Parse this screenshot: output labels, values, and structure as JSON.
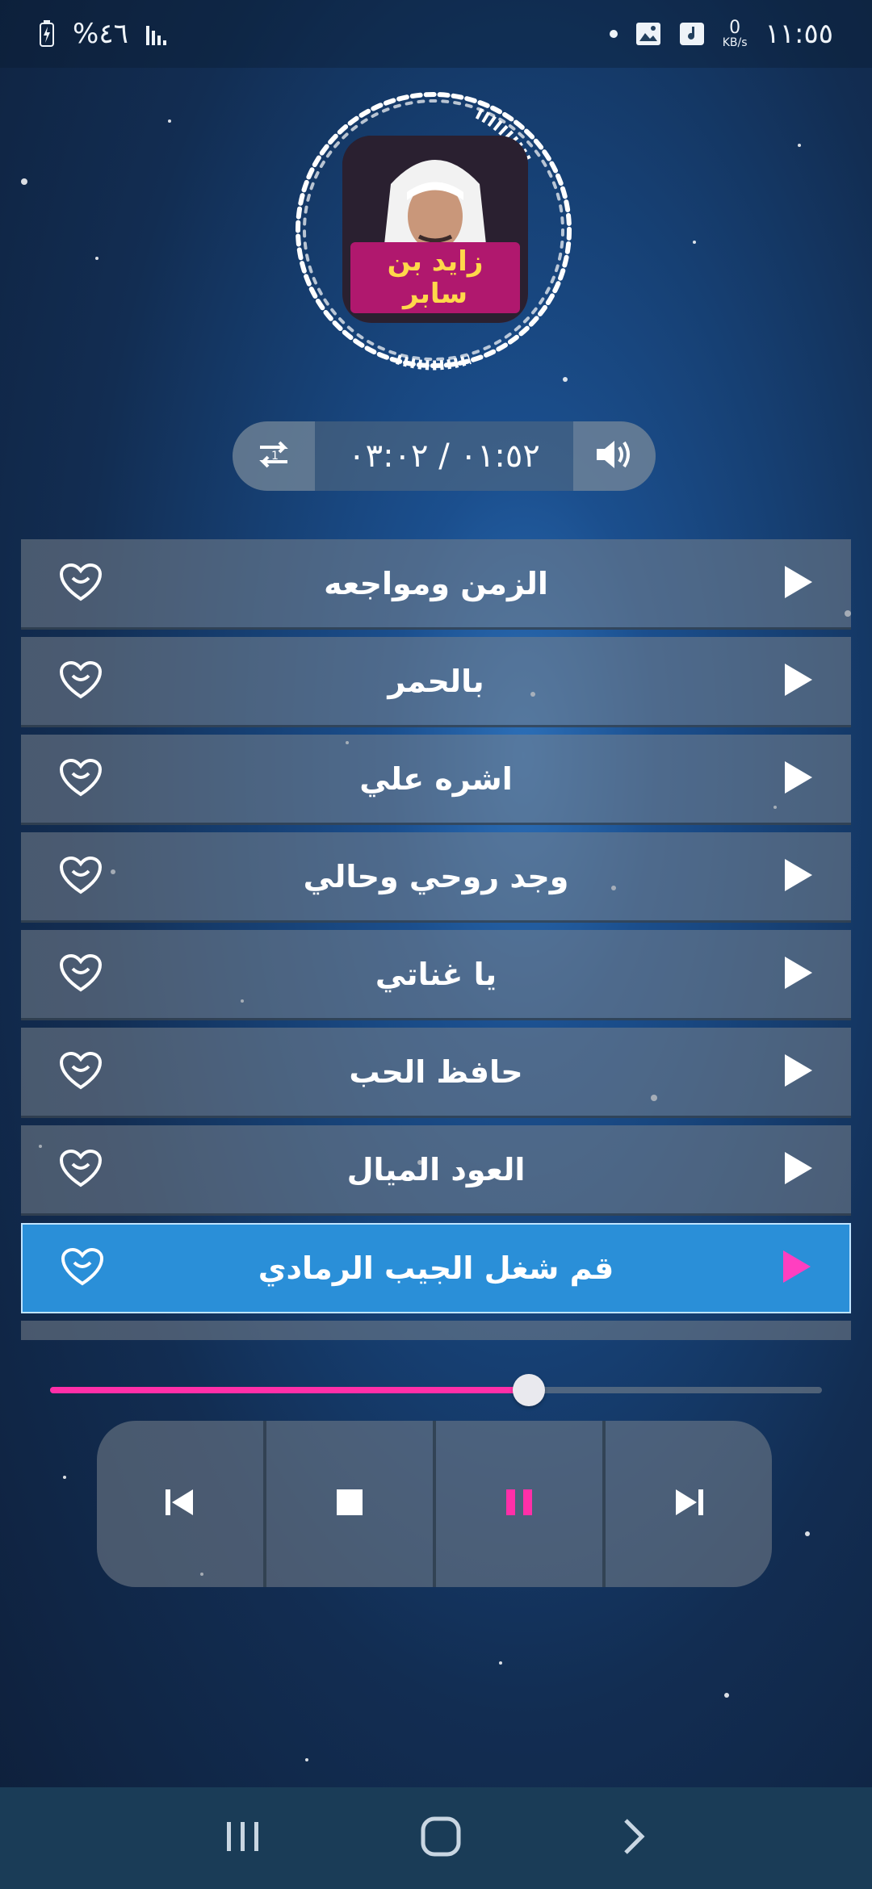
{
  "status_bar": {
    "battery_percent": "%٤٦",
    "net_speed_value": "0",
    "net_speed_unit": "KB/s",
    "clock": "١١:٥٥"
  },
  "artist": {
    "album_art_text": "زايد بن سابر"
  },
  "player": {
    "time_display": "٠١:٥٢ / ٠٣:٠٢",
    "progress_fraction": 0.62
  },
  "playlist": {
    "tracks": [
      {
        "title": "الزمن ومواجعه"
      },
      {
        "title": "بالحمر"
      },
      {
        "title": "اشره علي"
      },
      {
        "title": "وجد روحي وحالي"
      },
      {
        "title": "يا غناتي"
      },
      {
        "title": "حافظ الحب"
      },
      {
        "title": "العود الميال"
      },
      {
        "title": "قم شغل الجيب الرمادي"
      }
    ],
    "active_index": 7
  },
  "colors": {
    "accent_pink": "#ff2fa8",
    "active_row": "#2a8fd8",
    "navbar": "#1a3c57"
  },
  "icons": {
    "repeat": "repeat-one-icon",
    "volume": "volume-icon",
    "favorite": "heart-smile-icon",
    "play": "play-icon",
    "prev": "skip-previous-icon",
    "stop": "stop-icon",
    "pause": "pause-icon",
    "next": "skip-next-icon"
  }
}
